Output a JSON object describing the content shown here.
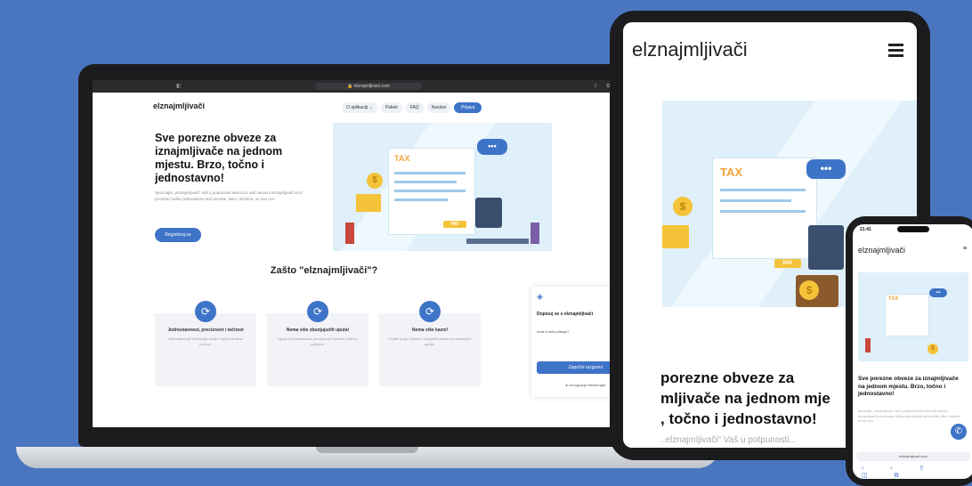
{
  "brand": {
    "name": "elznajmljivači",
    "accent": "#3e74c8",
    "background": "#4a76c0"
  },
  "laptop": {
    "browser": {
      "url": "elznajmljivaci.com"
    },
    "nav": {
      "items": [
        "O aplikaciji ⌄",
        "Paketi",
        "FAQ",
        "Naslovi"
      ],
      "login": "Prijava"
    },
    "hero": {
      "title": "Sve porezne obveze za iznajmljivače na jednom mjestu. Brzo, točno i jednostavno!",
      "description": "Spoznajte „eIznajmljivači“ Vaš u potpunosti web kroz vaš osnovni iIznajmljivači kroz prostrani koliko jednostavne koji razrede, tako i složene, uz sve ovo.",
      "cta": "Registriraj se"
    },
    "illustration": {
      "tax": "TAX",
      "pay": "PAY",
      "dollar": "$",
      "dots": "•••"
    },
    "why": {
      "title": "Zašto \"elznajmljivači\"?",
      "cards": [
        {
          "icon": "refresh-icon",
          "title": "Jednostavnost, preciznost i točnost",
          "text": "Jednostavnost korištenja, točan i točan obračun poreza."
        },
        {
          "icon": "refresh-icon",
          "title": "Nema više zbunjujućih uputa!",
          "text": "Uputa je jednostavna, provjereno i složeno, točna i potpuna."
        },
        {
          "icon": "refresh-icon",
          "title": "Nema više kazni!",
          "text": "Pratite svoje obveze i izbjegnite kazne za zakašnjele uplate."
        }
      ]
    },
    "chat": {
      "title": "Dopisuj se s elznajmljivači",
      "question": "Imaš li neko pitanje?",
      "start": "Započni razgovor",
      "footer": "Omogućuje Messenger"
    }
  },
  "tablet": {
    "heading_lines": [
      "porezne obveze za",
      "mljivače na jednom mje",
      ", točno i jednostavno!"
    ],
    "subline": "..elznajmljivači\" Vaš u potpunosti..."
  },
  "phone": {
    "time": "21:41",
    "title": "Sve porezne obveze za iznajmljivače na jednom mjestu. Brzo, točno i jednostavno!",
    "url": "elznajmljivaci.com"
  }
}
